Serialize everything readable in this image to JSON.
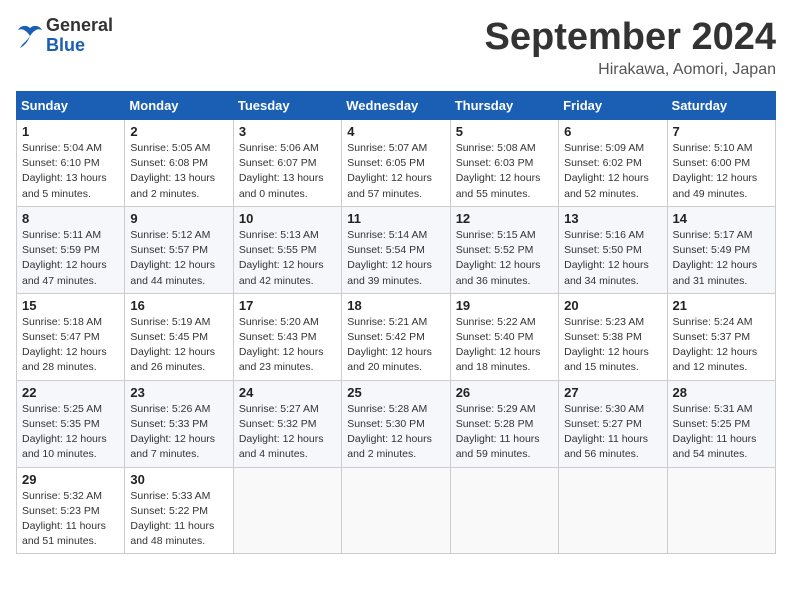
{
  "header": {
    "logo_general": "General",
    "logo_blue": "Blue",
    "month_title": "September 2024",
    "location": "Hirakawa, Aomori, Japan"
  },
  "weekdays": [
    "Sunday",
    "Monday",
    "Tuesday",
    "Wednesday",
    "Thursday",
    "Friday",
    "Saturday"
  ],
  "weeks": [
    [
      {
        "day": "1",
        "sunrise": "5:04 AM",
        "sunset": "6:10 PM",
        "daylight": "13 hours and 5 minutes."
      },
      {
        "day": "2",
        "sunrise": "5:05 AM",
        "sunset": "6:08 PM",
        "daylight": "13 hours and 2 minutes."
      },
      {
        "day": "3",
        "sunrise": "5:06 AM",
        "sunset": "6:07 PM",
        "daylight": "13 hours and 0 minutes."
      },
      {
        "day": "4",
        "sunrise": "5:07 AM",
        "sunset": "6:05 PM",
        "daylight": "12 hours and 57 minutes."
      },
      {
        "day": "5",
        "sunrise": "5:08 AM",
        "sunset": "6:03 PM",
        "daylight": "12 hours and 55 minutes."
      },
      {
        "day": "6",
        "sunrise": "5:09 AM",
        "sunset": "6:02 PM",
        "daylight": "12 hours and 52 minutes."
      },
      {
        "day": "7",
        "sunrise": "5:10 AM",
        "sunset": "6:00 PM",
        "daylight": "12 hours and 49 minutes."
      }
    ],
    [
      {
        "day": "8",
        "sunrise": "5:11 AM",
        "sunset": "5:59 PM",
        "daylight": "12 hours and 47 minutes."
      },
      {
        "day": "9",
        "sunrise": "5:12 AM",
        "sunset": "5:57 PM",
        "daylight": "12 hours and 44 minutes."
      },
      {
        "day": "10",
        "sunrise": "5:13 AM",
        "sunset": "5:55 PM",
        "daylight": "12 hours and 42 minutes."
      },
      {
        "day": "11",
        "sunrise": "5:14 AM",
        "sunset": "5:54 PM",
        "daylight": "12 hours and 39 minutes."
      },
      {
        "day": "12",
        "sunrise": "5:15 AM",
        "sunset": "5:52 PM",
        "daylight": "12 hours and 36 minutes."
      },
      {
        "day": "13",
        "sunrise": "5:16 AM",
        "sunset": "5:50 PM",
        "daylight": "12 hours and 34 minutes."
      },
      {
        "day": "14",
        "sunrise": "5:17 AM",
        "sunset": "5:49 PM",
        "daylight": "12 hours and 31 minutes."
      }
    ],
    [
      {
        "day": "15",
        "sunrise": "5:18 AM",
        "sunset": "5:47 PM",
        "daylight": "12 hours and 28 minutes."
      },
      {
        "day": "16",
        "sunrise": "5:19 AM",
        "sunset": "5:45 PM",
        "daylight": "12 hours and 26 minutes."
      },
      {
        "day": "17",
        "sunrise": "5:20 AM",
        "sunset": "5:43 PM",
        "daylight": "12 hours and 23 minutes."
      },
      {
        "day": "18",
        "sunrise": "5:21 AM",
        "sunset": "5:42 PM",
        "daylight": "12 hours and 20 minutes."
      },
      {
        "day": "19",
        "sunrise": "5:22 AM",
        "sunset": "5:40 PM",
        "daylight": "12 hours and 18 minutes."
      },
      {
        "day": "20",
        "sunrise": "5:23 AM",
        "sunset": "5:38 PM",
        "daylight": "12 hours and 15 minutes."
      },
      {
        "day": "21",
        "sunrise": "5:24 AM",
        "sunset": "5:37 PM",
        "daylight": "12 hours and 12 minutes."
      }
    ],
    [
      {
        "day": "22",
        "sunrise": "5:25 AM",
        "sunset": "5:35 PM",
        "daylight": "12 hours and 10 minutes."
      },
      {
        "day": "23",
        "sunrise": "5:26 AM",
        "sunset": "5:33 PM",
        "daylight": "12 hours and 7 minutes."
      },
      {
        "day": "24",
        "sunrise": "5:27 AM",
        "sunset": "5:32 PM",
        "daylight": "12 hours and 4 minutes."
      },
      {
        "day": "25",
        "sunrise": "5:28 AM",
        "sunset": "5:30 PM",
        "daylight": "12 hours and 2 minutes."
      },
      {
        "day": "26",
        "sunrise": "5:29 AM",
        "sunset": "5:28 PM",
        "daylight": "11 hours and 59 minutes."
      },
      {
        "day": "27",
        "sunrise": "5:30 AM",
        "sunset": "5:27 PM",
        "daylight": "11 hours and 56 minutes."
      },
      {
        "day": "28",
        "sunrise": "5:31 AM",
        "sunset": "5:25 PM",
        "daylight": "11 hours and 54 minutes."
      }
    ],
    [
      {
        "day": "29",
        "sunrise": "5:32 AM",
        "sunset": "5:23 PM",
        "daylight": "11 hours and 51 minutes."
      },
      {
        "day": "30",
        "sunrise": "5:33 AM",
        "sunset": "5:22 PM",
        "daylight": "11 hours and 48 minutes."
      },
      null,
      null,
      null,
      null,
      null
    ]
  ],
  "labels": {
    "sunrise_prefix": "Sunrise: ",
    "sunset_prefix": "Sunset: ",
    "daylight_prefix": "Daylight: "
  }
}
